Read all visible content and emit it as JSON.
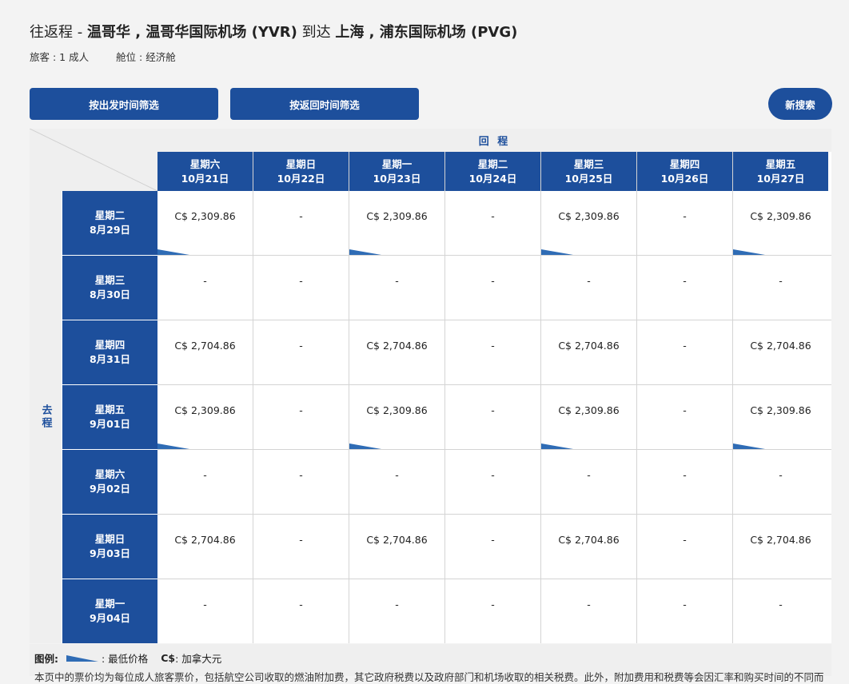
{
  "header": {
    "trip_type": "往返程 - ",
    "origin": "温哥华 , 温哥华国际机场 (YVR)",
    "to_word": " 到达 ",
    "destination": "上海 , 浦东国际机场 (PVG)",
    "passengers": "旅客 : 1 成人",
    "cabin": "舱位 : 经济舱"
  },
  "buttons": {
    "filter_outbound": "按出发时间筛选",
    "filter_return": "按返回时间筛选",
    "new_search": "新搜索"
  },
  "grid": {
    "return_label": "回 程",
    "outbound_label": "去程",
    "return_dates": [
      {
        "day": "星期六",
        "date": "10月21日"
      },
      {
        "day": "星期日",
        "date": "10月22日"
      },
      {
        "day": "星期一",
        "date": "10月23日"
      },
      {
        "day": "星期二",
        "date": "10月24日"
      },
      {
        "day": "星期三",
        "date": "10月25日"
      },
      {
        "day": "星期四",
        "date": "10月26日"
      },
      {
        "day": "星期五",
        "date": "10月27日"
      }
    ],
    "outbound_dates": [
      {
        "day": "星期二",
        "date": "8月29日"
      },
      {
        "day": "星期三",
        "date": "8月30日"
      },
      {
        "day": "星期四",
        "date": "8月31日"
      },
      {
        "day": "星期五",
        "date": "9月01日"
      },
      {
        "day": "星期六",
        "date": "9月02日"
      },
      {
        "day": "星期日",
        "date": "9月03日"
      },
      {
        "day": "星期一",
        "date": "9月04日"
      }
    ],
    "prices": [
      [
        "C$ 2,309.86",
        "-",
        "C$ 2,309.86",
        "-",
        "C$ 2,309.86",
        "-",
        "C$ 2,309.86"
      ],
      [
        "-",
        "-",
        "-",
        "-",
        "-",
        "-",
        "-"
      ],
      [
        "C$ 2,704.86",
        "-",
        "C$ 2,704.86",
        "-",
        "C$ 2,704.86",
        "-",
        "C$ 2,704.86"
      ],
      [
        "C$ 2,309.86",
        "-",
        "C$ 2,309.86",
        "-",
        "C$ 2,309.86",
        "-",
        "C$ 2,309.86"
      ],
      [
        "-",
        "-",
        "-",
        "-",
        "-",
        "-",
        "-"
      ],
      [
        "C$ 2,704.86",
        "-",
        "C$ 2,704.86",
        "-",
        "C$ 2,704.86",
        "-",
        "C$ 2,704.86"
      ],
      [
        "-",
        "-",
        "-",
        "-",
        "-",
        "-",
        "-"
      ]
    ],
    "lowest": [
      [
        true,
        false,
        true,
        false,
        true,
        false,
        true
      ],
      [
        false,
        false,
        false,
        false,
        false,
        false,
        false
      ],
      [
        false,
        false,
        false,
        false,
        false,
        false,
        false
      ],
      [
        true,
        false,
        true,
        false,
        true,
        false,
        true
      ],
      [
        false,
        false,
        false,
        false,
        false,
        false,
        false
      ],
      [
        false,
        false,
        false,
        false,
        false,
        false,
        false
      ],
      [
        false,
        false,
        false,
        false,
        false,
        false,
        false
      ]
    ]
  },
  "legend": {
    "label": "图例:",
    "lowest_price": ": 最低价格",
    "currency_code": "C$",
    "currency_name": ": 加拿大元",
    "note": "本页中的票价均为每位成人旅客票价，包括航空公司收取的燃油附加费，其它政府税费以及政府部门和机场收取的相关税费。此外，附加费用和税费等会因汇率和购买时间的不同而"
  },
  "colors": {
    "accent": "#1d4f9c",
    "lowest_marker": "#2f6cb5",
    "background": "#f3f3f3"
  }
}
